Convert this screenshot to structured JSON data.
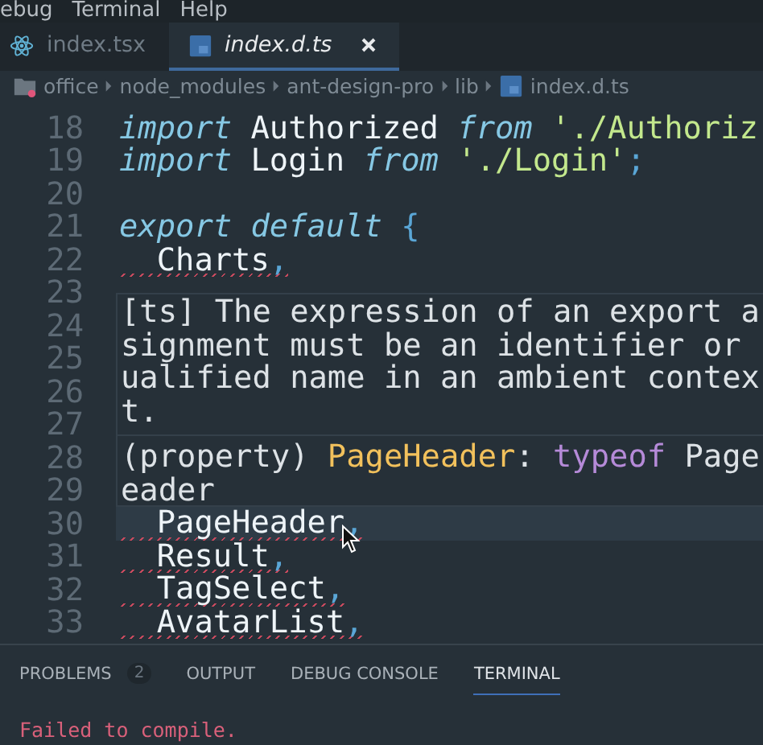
{
  "menu": [
    "ebug",
    "Terminal",
    "Help"
  ],
  "tabs": [
    {
      "label": "index.tsx",
      "selected": false
    },
    {
      "label": "index.d.ts",
      "selected": true
    }
  ],
  "breadcrumb": [
    "office",
    "node_modules",
    "ant-design-pro",
    "lib",
    "index.d.ts"
  ],
  "code": {
    "line_numbers": [
      "18",
      "19",
      "20",
      "21",
      "22",
      "23",
      "24",
      "25",
      "26",
      "27",
      "28",
      "29",
      "30",
      "31",
      "32",
      "33"
    ],
    "lines": [
      {
        "current": false,
        "error": false,
        "tokens": [
          {
            "text": "import",
            "kind": "keyword"
          },
          {
            "text": " Authorized ",
            "kind": "plain"
          },
          {
            "text": "from",
            "kind": "keyword"
          },
          {
            "text": " './Authoriz",
            "kind": "string"
          }
        ]
      },
      {
        "current": false,
        "error": false,
        "tokens": [
          {
            "text": "import",
            "kind": "keyword"
          },
          {
            "text": " Login ",
            "kind": "plain"
          },
          {
            "text": "from",
            "kind": "keyword"
          },
          {
            "text": " './Login'",
            "kind": "string"
          },
          {
            "text": ";",
            "kind": "punct"
          }
        ]
      },
      {
        "current": false,
        "error": false
      },
      {
        "current": false,
        "error": false,
        "tokens": [
          {
            "text": "export default",
            "kind": "keyword"
          },
          {
            "text": " {",
            "kind": "punct"
          }
        ]
      },
      {
        "current": false,
        "error": true,
        "tokens": [
          {
            "text": "  Charts",
            "kind": "plain"
          },
          {
            "text": ",",
            "kind": "punct"
          }
        ]
      },
      {
        "current": true,
        "error": true,
        "tokens": [
          {
            "text": "  PageHeader",
            "kind": "plain"
          },
          {
            "text": ",",
            "kind": "punct"
          }
        ]
      },
      {
        "current": false,
        "error": true,
        "tokens": [
          {
            "text": "  Result",
            "kind": "plain"
          },
          {
            "text": ",",
            "kind": "punct"
          }
        ]
      },
      {
        "current": false,
        "error": true,
        "tokens": [
          {
            "text": "  TagSelect",
            "kind": "plain"
          },
          {
            "text": ",",
            "kind": "punct"
          }
        ]
      },
      {
        "current": false,
        "error": true,
        "tokens": [
          {
            "text": "  AvatarList",
            "kind": "plain"
          },
          {
            "text": ",",
            "kind": "punct"
          }
        ]
      }
    ]
  },
  "hover": {
    "message": [
      "[ts] The expression of an export a",
      "signment must be an identifier or",
      "ualified name in an ambient contex",
      "t."
    ],
    "signature": [
      [
        {
          "text": "(property) ",
          "kind": "plain"
        },
        {
          "text": "PageHeader",
          "kind": "name"
        },
        {
          "text": ": ",
          "kind": "plain"
        },
        {
          "text": "typeof",
          "kind": "type"
        },
        {
          "text": " Page",
          "kind": "plain"
        }
      ],
      [
        {
          "text": "eader",
          "kind": "plain"
        }
      ]
    ]
  },
  "panel": {
    "tabs": [
      {
        "label": "PROBLEMS",
        "badge": "2",
        "selected": false
      },
      {
        "label": "OUTPUT",
        "selected": false
      },
      {
        "label": "DEBUG CONSOLE",
        "selected": false
      },
      {
        "label": "TERMINAL",
        "selected": true
      }
    ],
    "terminal": [
      "Failed to compile."
    ]
  }
}
